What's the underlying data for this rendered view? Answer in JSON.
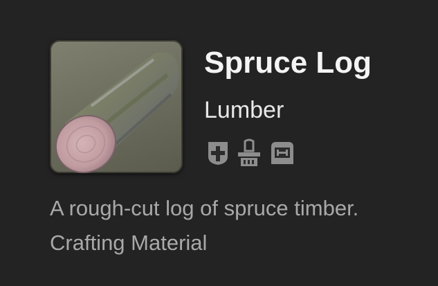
{
  "item": {
    "name": "Spruce Log",
    "category": "Lumber",
    "description": "A rough-cut log of spruce timber.",
    "type": "Crafting Material",
    "icon": "spruce-log-icon"
  },
  "restriction_icons": [
    "armoire-storage-icon",
    "desynthesis-icon",
    "materia-icon"
  ],
  "colors": {
    "background": "#232323",
    "title_text": "#f4f4f4",
    "secondary_text": "#a9a9a9"
  }
}
